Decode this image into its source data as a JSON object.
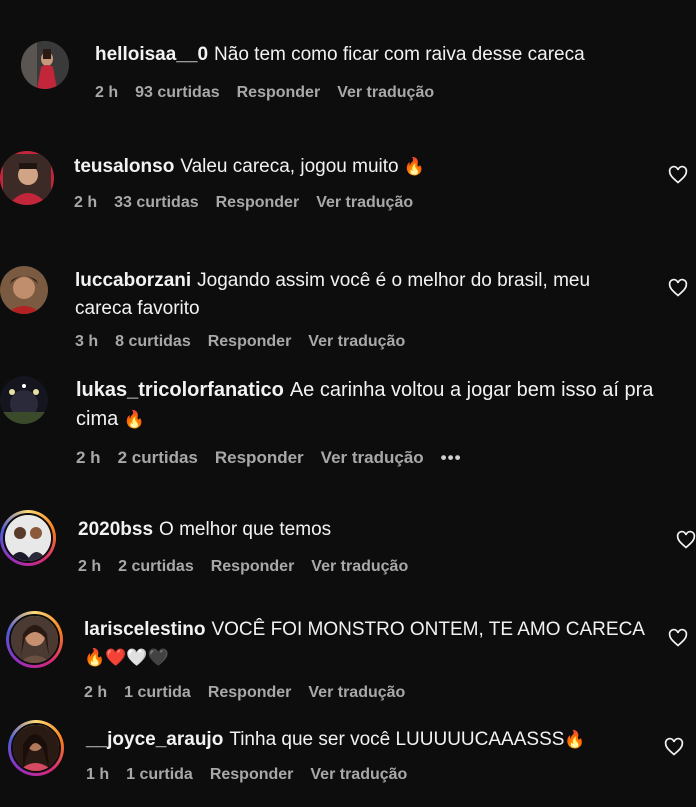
{
  "comments": [
    {
      "user": "helloisaa__0",
      "text": "Não tem como ficar com raiva desse careca",
      "time": "2 h",
      "likes": "93 curtidas",
      "reply": "Responder",
      "translate": "Ver tradução"
    },
    {
      "user": "teusalonso",
      "text": "Valeu careca, jogou muito",
      "emoji": "🔥",
      "time": "2 h",
      "likes": "33 curtidas",
      "reply": "Responder",
      "translate": "Ver tradução"
    },
    {
      "user": "luccaborzani",
      "text": "Jogando assim você é o melhor do brasil, meu careca favorito",
      "time": "3 h",
      "likes": "8 curtidas",
      "reply": "Responder",
      "translate": "Ver tradução"
    },
    {
      "user": "lukas_tricolorfanatico",
      "text": "Ae carinha voltou a jogar bem isso aí pra cima",
      "emoji": "🔥",
      "time": "2 h",
      "likes": "2 curtidas",
      "reply": "Responder",
      "translate": "Ver tradução",
      "more": "•••"
    },
    {
      "user": "2020bss",
      "text": "O melhor que temos",
      "time": "2 h",
      "likes": "2 curtidas",
      "reply": "Responder",
      "translate": "Ver tradução"
    },
    {
      "user": "lariscelestino",
      "text": "VOCÊ FOI MONSTRO ONTEM, TE AMO CARECA",
      "emoji": "🔥❤️🤍🖤",
      "time": "2 h",
      "likes": "1 curtida",
      "reply": "Responder",
      "translate": "Ver tradução"
    },
    {
      "user": "__joyce_araujo",
      "text": "Tinha que ser você LUUUUUCAAASSS",
      "emoji": "🔥",
      "time": "1 h",
      "likes": "1 curtida",
      "reply": "Responder",
      "translate": "Ver tradução"
    }
  ],
  "colors": {
    "background": "#0d0d0d",
    "meta": "#a8a8a8",
    "text": "#f2f2f2"
  },
  "icons": {
    "like": "heart-outline-icon",
    "more": "more-dots-icon"
  }
}
